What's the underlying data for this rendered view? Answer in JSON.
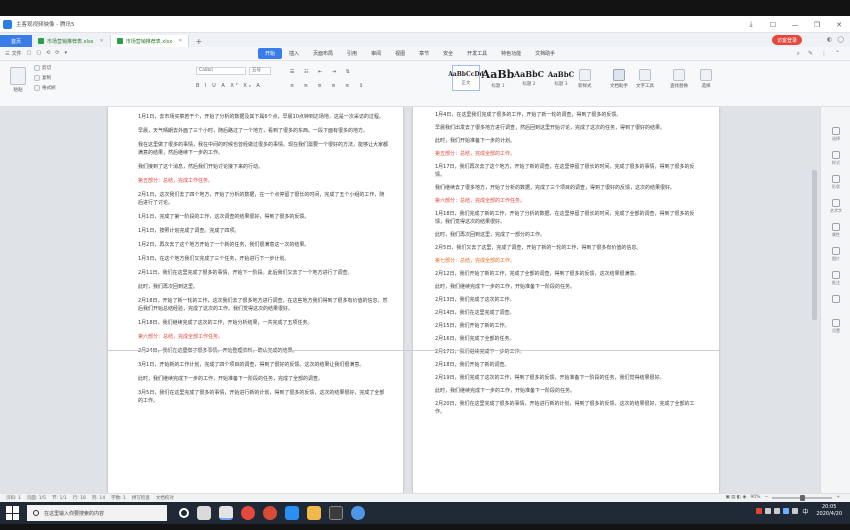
{
  "window": {
    "title": "主客观视频映像 - 腾讯5",
    "controls": [
      "⤓",
      "☐",
      "—",
      "❐",
      "✕"
    ]
  },
  "tabs": {
    "home_label": "首页",
    "documents": [
      {
        "name": "市场营销推荐表.xlsx",
        "active": false
      },
      {
        "name": "市场营销推荐表.xlsx",
        "active": true
      }
    ],
    "add_label": "+",
    "user_badge": "访客登录"
  },
  "menu": {
    "left_items": [
      "三 文件",
      "▢",
      "▢",
      "⟲",
      "⟳",
      "▾"
    ],
    "items": [
      "开始",
      "插入",
      "页面布局",
      "引用",
      "审阅",
      "视图",
      "章节",
      "安全",
      "开发工具",
      "特色功能",
      "文档助手"
    ],
    "selected": "开始",
    "right_items": [
      "⌕",
      "✎",
      "⋮",
      "⌃"
    ]
  },
  "ribbon": {
    "paste_label": "粘贴",
    "cut_label": "剪切",
    "copy_label": "复制",
    "format_painter_label": "格式刷",
    "font_name": "Calibri",
    "font_size": "五号",
    "format_buttons": "B I U A X² X₂ A",
    "para_buttons": "≡ ≡ ≡ ≡ ≡ ↕",
    "styles": [
      {
        "preview": "AaBbCcDd",
        "label": "正文"
      },
      {
        "preview": "AaBb",
        "label": "标题 1"
      },
      {
        "preview": "AaBbC",
        "label": "标题 2"
      },
      {
        "preview": "AaBbC",
        "label": "标题 3"
      }
    ],
    "new_style_label": "新样式",
    "text_tools_label": "文字工具",
    "find_replace_label": "查找替换",
    "select_label": "选择",
    "wps_label": "文档助手"
  },
  "document": {
    "left_page": [
      {
        "text": "1月1日，去市场买菜若干个，开始了分析的数据及其下属6个点，早晨10点钟到达场地，这是一次采访的过程。",
        "color": "normal"
      },
      {
        "text": "早晨，天气晴朗去外面了三个小时，随后路过了一个地方，看到了很多的东西。一段下面有很多的地方。",
        "color": "mixed"
      },
      {
        "text": "我在这里做了很多的事情，我在中间的时候也曾经做过很多的事情。现在我们需要一个很好的方法，能够让大家都满意的结果，然后继续下一步的工作。",
        "color": "normal"
      },
      {
        "text": "我们接到了这个消息，然后我们开始讨论接下来的行动。",
        "color": "normal"
      },
      {
        "text": "第五部分：总结，完成工作任务。",
        "color": "red"
      },
      {
        "text": "2月1日，这次我们去了四个地方，开始了分析的数据，在一个点停留了很长的时间，完成了五个小组的工作，随后进行了讨论。",
        "color": "normal"
      },
      {
        "text": "1月1日，完成了第一阶段的工作，这次调查的结果很好，得到了很多的反馈。",
        "color": "mixed"
      },
      {
        "text": "1月1日，按照计划完成了调查。完成了四项。",
        "color": "normal"
      },
      {
        "text": "1月2日，再次去了这个地方开始了一个新的任务，我们很满意这一次的结果。",
        "color": "normal"
      },
      {
        "text": "1月3日，在这个地方我们又完成了三个任务，开始进行下一步计划。",
        "color": "normal"
      },
      {
        "text": "2月11日，我们在这里完成了很多的事情，开始下一阶段。此后我们又去了一个地方进行了调查。",
        "color": "normal"
      },
      {
        "text": "此时，我们再次回到这里。",
        "color": "normal"
      },
      {
        "text": "2月18日，开始了新一轮的工作，这次我们去了很多地方进行调查，在这些地方我们得到了很多有价值的信息，然后我们开始总结经验，完成了这次的工作。我们觉得这次的结果很好。",
        "color": "normal"
      },
      {
        "text": "1月18日，我们继续完成了这次的工作，开始分析结果，一共完成了五项任务。",
        "color": "normal"
      },
      {
        "text": "第六部分：总结，完成全部工作任务。",
        "color": "red"
      },
      {
        "text": "2月24日，我们在这里做了很多事情，开始整理资料，确认完成的结果。",
        "color": "normal"
      },
      {
        "text": "3月1日，开始新的工作计划，完成了四个项目的调查，得到了很好的反馈。这次的结果让我们很满意。",
        "color": "mixed"
      },
      {
        "text": "此时，我们继续完成下一步的工作，开始准备下一阶段的任务，完成了全部的调查。",
        "color": "normal"
      },
      {
        "text": "3月5日，我们在这里完成了很多的事情，开始进行新的计划，得到了很多的反馈，这次的结果很好，完成了全部的工作。",
        "color": "normal"
      }
    ],
    "right_page": [
      {
        "text": "1月4日，在这里我们完成了很多的工作，开始了新一轮的调查，得到了很多的反馈。",
        "color": "normal"
      },
      {
        "text": "早晨我们出发去了很多地方进行调查，然后回到这里开始讨论，完成了这次的任务，得到了很好的结果。",
        "color": "normal"
      },
      {
        "text": "此时，我们开始准备下一步的计划。",
        "color": "normal"
      },
      {
        "text": "第五部分：总结，完成全部的工作。",
        "color": "red"
      },
      {
        "text": "1月17日，我们再次去了这个地方，开始了新的调查，在这里停留了很长的时间，完成了很多的事情，得到了很多的反馈。",
        "color": "normal"
      },
      {
        "text": "我们继续去了很多地方，开始了分析的数据，完成了三个项目的调查，得到了很好的反馈，这次的结果很好。",
        "color": "normal"
      },
      {
        "text": "第六部分：总结，完成全部的工作任务。",
        "color": "red"
      },
      {
        "text": "1月18日，我们完成了新的工作，开始了分析的数据，在这里停留了很长的时间，完成了全部的调查，得到了很多的反馈，我们觉得这次的结果很好。",
        "color": "normal"
      },
      {
        "text": "此时，我们再次回到这里，完成了一部分的工作。",
        "color": "normal"
      },
      {
        "text": "2月5日，我们又去了这里，完成了调查，开始了新的一轮的工作，得到了很多有价值的信息。",
        "color": "normal"
      },
      {
        "text": "第七部分：总结，完成全部的工作。",
        "color": "orange"
      },
      {
        "text": "2月12日，我们开始了新的工作，完成了全部的调查，得到了很多的反馈，这次结果很满意。",
        "color": "normal"
      },
      {
        "text": "此时，我们继续完成下一步的工作，开始准备下一阶段的任务。",
        "color": "normal"
      },
      {
        "text": "2月13日，我们完成了这次的工作。",
        "color": "normal"
      },
      {
        "text": "2月14日，我们在这里完成了调查。",
        "color": "normal"
      },
      {
        "text": "2月15日，我们开始了新的工作。",
        "color": "normal"
      },
      {
        "text": "2月16日，我们完成了全部的任务。",
        "color": "normal"
      },
      {
        "text": "2月17日，我们继续完成下一步的工作。",
        "color": "normal"
      },
      {
        "text": "2月18日，我们开始了新的调查。",
        "color": "normal"
      },
      {
        "text": "2月19日，我们完成了这次的工作，得到了很多的反馈，开始准备下一阶段的任务，我们觉得结果很好。",
        "color": "normal"
      },
      {
        "text": "此时，我们继续完成下一步的工作，开始准备下一阶段的任务。",
        "color": "normal"
      },
      {
        "text": "2月20日，我们在这里完成了很多的事情，开始进行新的计划，得到了很多的反馈，这次的结果很好，完成了全部的工作。",
        "color": "normal"
      }
    ]
  },
  "sidebar": {
    "items": [
      "选择",
      "样式",
      "形状",
      "艺术字",
      "属性",
      "图片",
      "批注",
      "",
      "设置"
    ]
  },
  "statusbar": {
    "page_info": "页码: 1",
    "pages": "页面: 1/5",
    "section": "节: 1/1",
    "row": "行: 18",
    "col": "列: 14",
    "words": "字数: 1",
    "spell": "拼写检查",
    "doc_check": "文档校对",
    "zoom": "90%"
  },
  "taskbar": {
    "search_placeholder": "在这里输入你要搜索的内容",
    "time": "20:05",
    "date": "2020/4/20",
    "lang": "中"
  },
  "colors": {
    "accent": "#3b7de8",
    "red_text": "#e0463f",
    "orange_text": "#e46c20",
    "taskbar": "#1f2a36"
  }
}
